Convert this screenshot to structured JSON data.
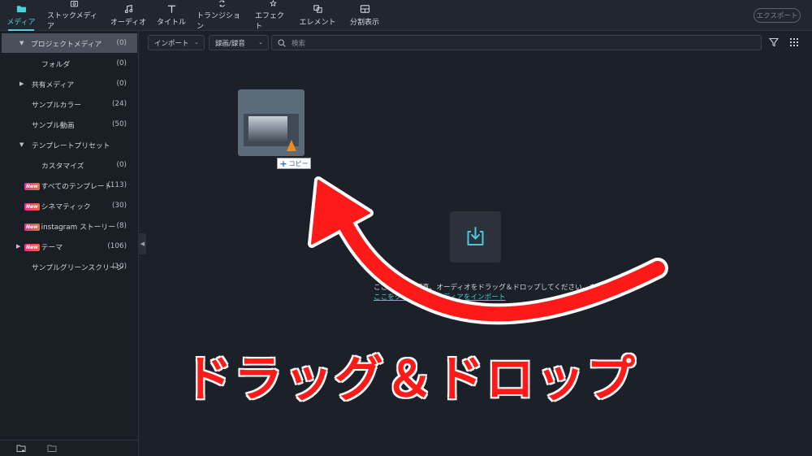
{
  "colors": {
    "accent": "#4fd1d9",
    "annotation": "#ff1a1a",
    "link": "#43c9c9",
    "new_badge": "#e0338c"
  },
  "toolbar": {
    "tabs": [
      {
        "label": "メディア",
        "icon": "folder-icon",
        "active": true
      },
      {
        "label": "ストックメディア",
        "icon": "stock-media-icon",
        "active": false
      },
      {
        "label": "オーディオ",
        "icon": "music-note-icon",
        "active": false
      },
      {
        "label": "タイトル",
        "icon": "text-t-icon",
        "active": false
      },
      {
        "label": "トランジション",
        "icon": "transition-icon",
        "active": false
      },
      {
        "label": "エフェクト",
        "icon": "effects-icon",
        "active": false
      },
      {
        "label": "エレメント",
        "icon": "elements-icon",
        "active": false
      },
      {
        "label": "分割表示",
        "icon": "split-screen-icon",
        "active": false
      }
    ],
    "export_label": "エクスポート"
  },
  "sidebar": {
    "items": [
      {
        "label": "プロジェクトメディア",
        "count": "(0)",
        "caret": "▼"
      },
      {
        "label": "フォルダ",
        "count": "(0)",
        "caret": ""
      },
      {
        "label": "共有メディア",
        "count": "(0)",
        "caret": "▶"
      },
      {
        "label": "サンプルカラー",
        "count": "(24)",
        "caret": ""
      },
      {
        "label": "サンプル動画",
        "count": "(50)",
        "caret": ""
      },
      {
        "label": "テンプレートプリセット",
        "count": "",
        "caret": "▼"
      },
      {
        "label": "カスタマイズ",
        "count": "(0)",
        "caret": ""
      },
      {
        "label": "すべてのテンプレート",
        "count": "(113)",
        "caret": "",
        "badge": "New"
      },
      {
        "label": "シネマティック",
        "count": "(30)",
        "caret": "",
        "badge": "New"
      },
      {
        "label": "instagram ストーリー",
        "count": "(8)",
        "caret": "",
        "badge": "New"
      },
      {
        "label": "テーマ",
        "count": "(106)",
        "caret": "▶",
        "badge": "New"
      },
      {
        "label": "サンプルグリーンスクリーン",
        "count": "(10)",
        "caret": ""
      }
    ]
  },
  "filter": {
    "import_label": "インポート",
    "record_label": "録画/録音",
    "search_placeholder": "検索"
  },
  "media": {
    "copy_label": "コピー"
  },
  "empty_state": {
    "hint_text": "ここに動画、写真、オーディオをドラッグ＆ドロップしてください。または、",
    "link_text": "ここをクリックしてメディアをインポート"
  },
  "annotation": {
    "caption": "ドラッグ＆ドロップ"
  }
}
